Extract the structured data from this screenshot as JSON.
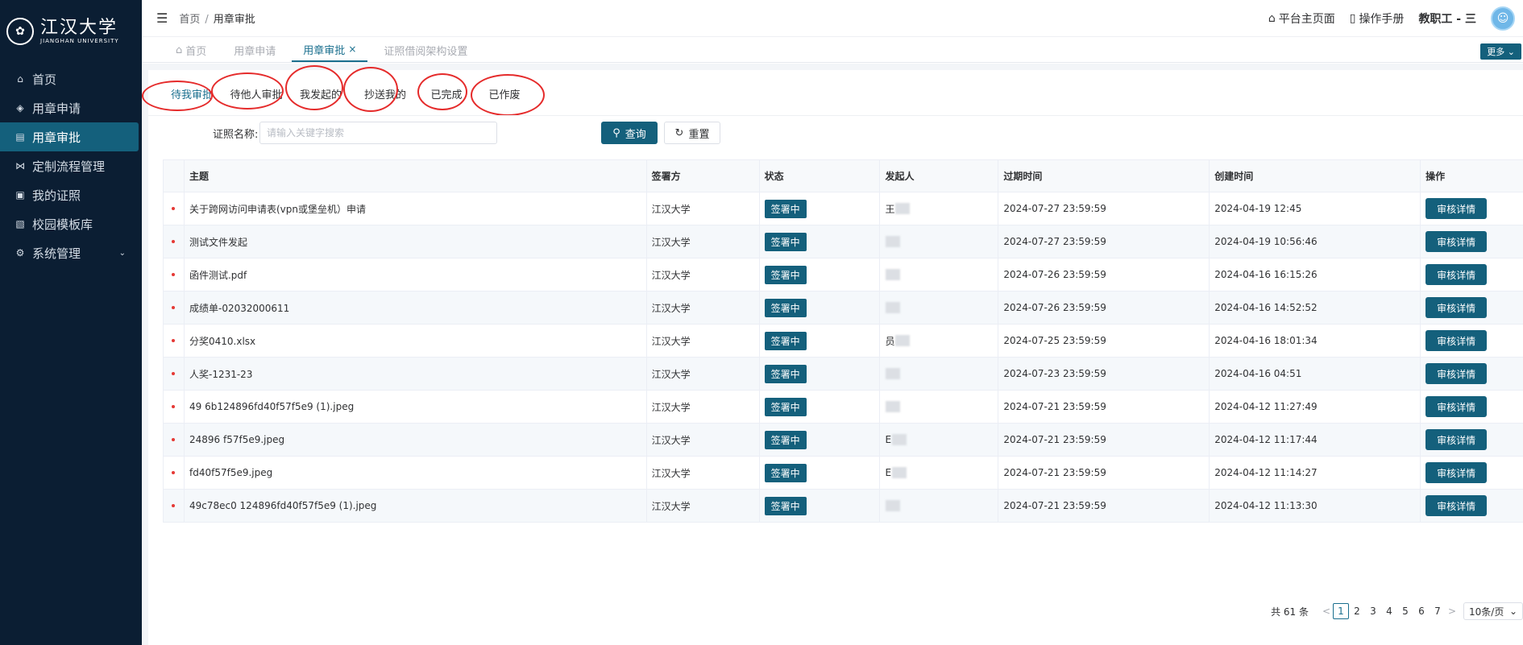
{
  "logo": {
    "cn": "江汉大学",
    "en": "JIANGHAN UNIVERSITY"
  },
  "sidebar": {
    "items": [
      {
        "label": "首页",
        "icon": "home-icon"
      },
      {
        "label": "用章申请",
        "icon": "apply-icon"
      },
      {
        "label": "用章审批",
        "icon": "approve-icon",
        "active": true
      },
      {
        "label": "定制流程管理",
        "icon": "flow-icon"
      },
      {
        "label": "我的证照",
        "icon": "license-icon"
      },
      {
        "label": "校园模板库",
        "icon": "template-icon"
      },
      {
        "label": "系统管理",
        "icon": "settings-icon"
      }
    ]
  },
  "header": {
    "breadcrumb_home": "首页",
    "breadcrumb_sep": "/",
    "breadcrumb_current": "用章审批",
    "platform_home": "平台主页面",
    "manual": "操作手册",
    "user": "教职工 - 三"
  },
  "tags": {
    "items": [
      "首页",
      "用章申请",
      "用章审批",
      "证照借阅架构设置"
    ],
    "close": "×",
    "more": "更多"
  },
  "subtabs": [
    "待我审批",
    "待他人审批",
    "我发起的",
    "抄送我的",
    "已完成",
    "已作废"
  ],
  "search": {
    "label": "证照名称:",
    "placeholder": "请输入关键字搜索",
    "query": "查询",
    "reset": "重置"
  },
  "table": {
    "headers": [
      "主题",
      "签署方",
      "状态",
      "发起人",
      "过期时间",
      "创建时间",
      "操作"
    ],
    "rows": [
      {
        "subject": "关于跨网访问申请表(vpn或堡垒机）申请",
        "party": "江汉大学",
        "status": "签署中",
        "initiator": "王",
        "expire": "2024-07-27 23:59:59",
        "created": "2024-04-19 12:45",
        "action": "审核详情"
      },
      {
        "subject": "测试文件发起",
        "party": "江汉大学",
        "status": "签署中",
        "initiator": "",
        "expire": "2024-07-27 23:59:59",
        "created": "2024-04-19 10:56:46",
        "action": "审核详情"
      },
      {
        "subject": "函件测试.pdf",
        "party": "江汉大学",
        "status": "签署中",
        "initiator": "",
        "expire": "2024-07-26 23:59:59",
        "created": "2024-04-16 16:15:26",
        "action": "审核详情"
      },
      {
        "subject": "成绩单-02032000611",
        "party": "江汉大学",
        "status": "签署中",
        "initiator": "",
        "expire": "2024-07-26 23:59:59",
        "created": "2024-04-16 14:52:52",
        "action": "审核详情"
      },
      {
        "subject": "分奖0410.xlsx",
        "party": "江汉大学",
        "status": "签署中",
        "initiator": "员",
        "expire": "2024-07-25 23:59:59",
        "created": "2024-04-16 18:01:34",
        "action": "审核详情"
      },
      {
        "subject": "人奖-1231-23",
        "party": "江汉大学",
        "status": "签署中",
        "initiator": "",
        "expire": "2024-07-23 23:59:59",
        "created": "2024-04-16 04:51",
        "action": "审核详情"
      },
      {
        "subject": "49 6b124896fd40f57f5e9 (1).jpeg",
        "party": "江汉大学",
        "status": "签署中",
        "initiator": "",
        "expire": "2024-07-21 23:59:59",
        "created": "2024-04-12 11:27:49",
        "action": "审核详情"
      },
      {
        "subject": "24896 f57f5e9.jpeg",
        "party": "江汉大学",
        "status": "签署中",
        "initiator": "E",
        "expire": "2024-07-21 23:59:59",
        "created": "2024-04-12 11:17:44",
        "action": "审核详情"
      },
      {
        "subject": "fd40f57f5e9.jpeg",
        "party": "江汉大学",
        "status": "签署中",
        "initiator": "E",
        "expire": "2024-07-21 23:59:59",
        "created": "2024-04-12 11:14:27",
        "action": "审核详情"
      },
      {
        "subject": "49c78ec0 124896fd40f57f5e9 (1).jpeg",
        "party": "江汉大学",
        "status": "签署中",
        "initiator": "",
        "expire": "2024-07-21 23:59:59",
        "created": "2024-04-12 11:13:30",
        "action": "审核详情"
      }
    ]
  },
  "pager": {
    "total": "共 61 条",
    "prev": "<",
    "next": ">",
    "pages": [
      "1",
      "2",
      "3",
      "4",
      "5",
      "6",
      "7"
    ],
    "size": "10条/页"
  },
  "colors": {
    "primary": "#14607c",
    "sidebar_bg": "#0b1e33",
    "highlight_circle": "#e52b2b"
  }
}
